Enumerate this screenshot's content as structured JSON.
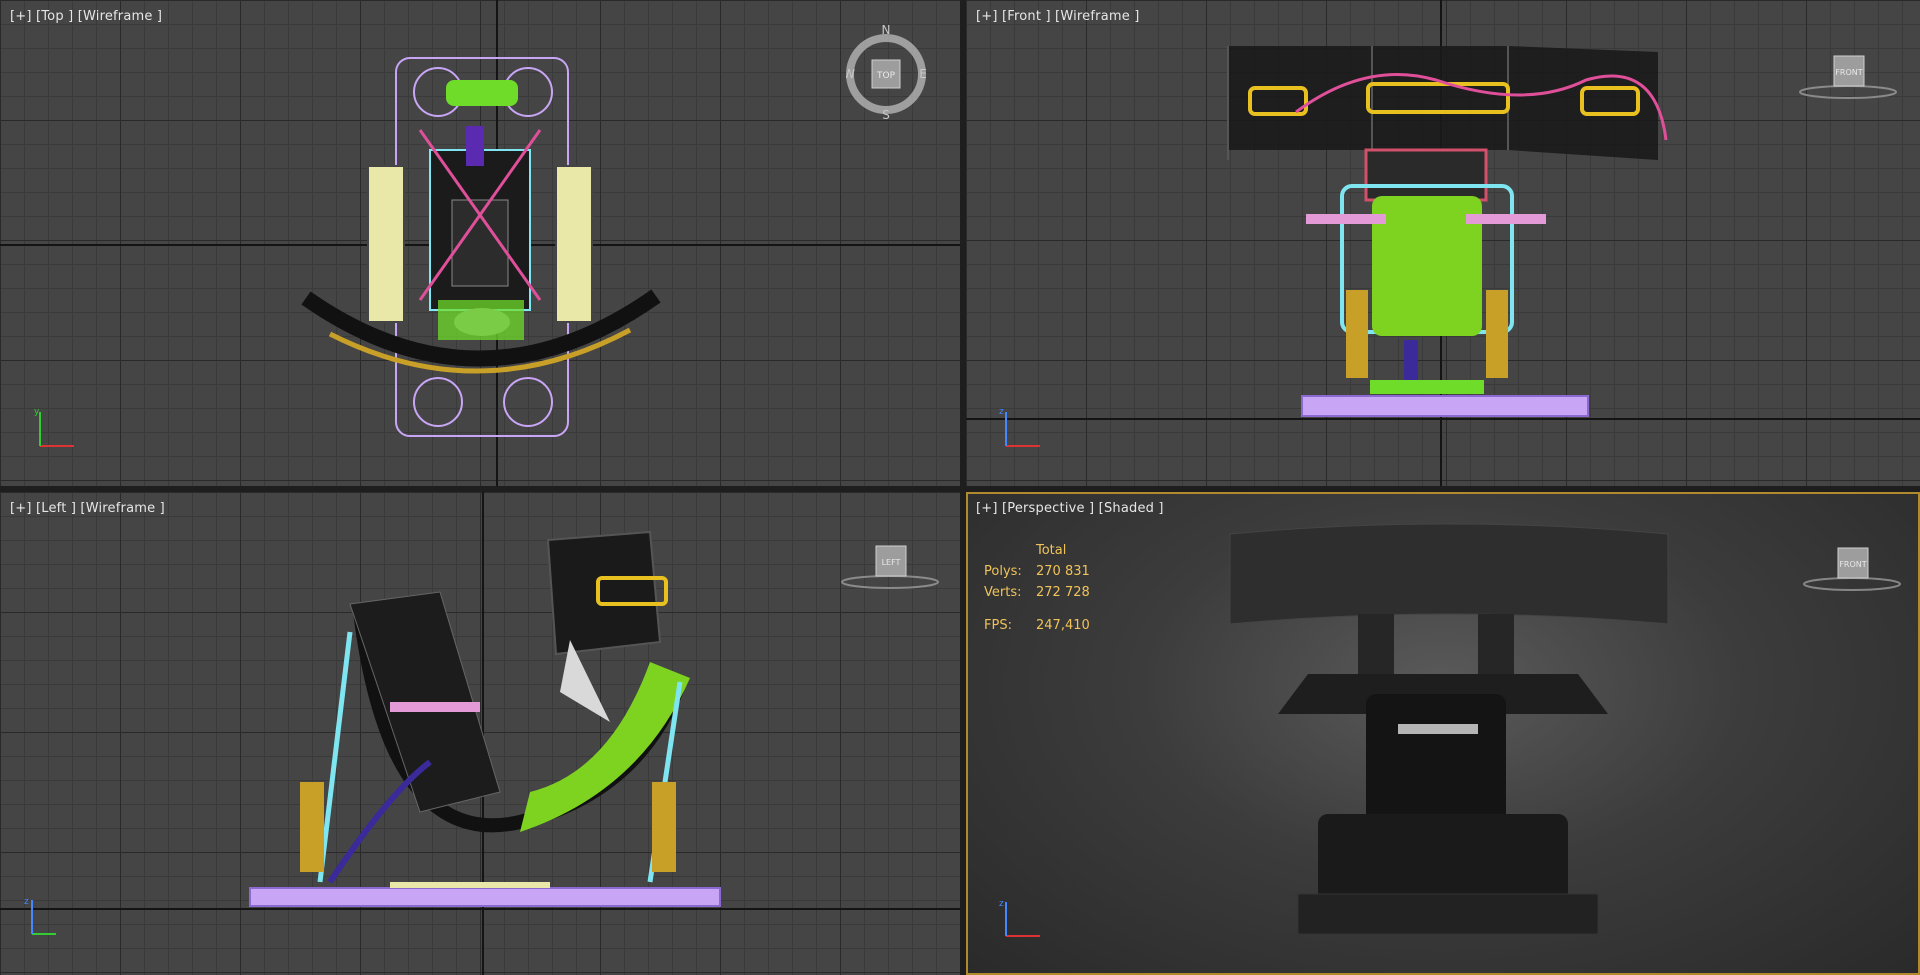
{
  "viewports": {
    "top": {
      "label": "[+] [Top ] [Wireframe ]",
      "compass": {
        "n": "N",
        "s": "S",
        "e": "E",
        "w": "W",
        "face": "TOP"
      }
    },
    "front": {
      "label": "[+] [Front ] [Wireframe ]",
      "cube_face": "FRONT"
    },
    "left": {
      "label": "[+] [Left ] [Wireframe ]",
      "cube_face": "LEFT"
    },
    "perspective": {
      "label": "[+] [Perspective ] [Shaded ]",
      "cube_face": "FRONT"
    }
  },
  "stats": {
    "header": "Total",
    "polys_label": "Polys:",
    "polys_value": "270 831",
    "verts_label": "Verts:",
    "verts_value": "272 728",
    "fps_label": "FPS:",
    "fps_value": "247,410"
  },
  "axis_labels": {
    "y": "y",
    "z": "z"
  },
  "colors": {
    "viewport_bg": "#454545",
    "active_border": "#b28a2e",
    "stats_text": "#f0c35a",
    "green_seat": "#7ed321",
    "cyan_frame": "#7fe5f0",
    "yellow_actuator": "#c8a028",
    "pink_cable": "#e0509a",
    "lavender_base": "#c9a6f5"
  }
}
